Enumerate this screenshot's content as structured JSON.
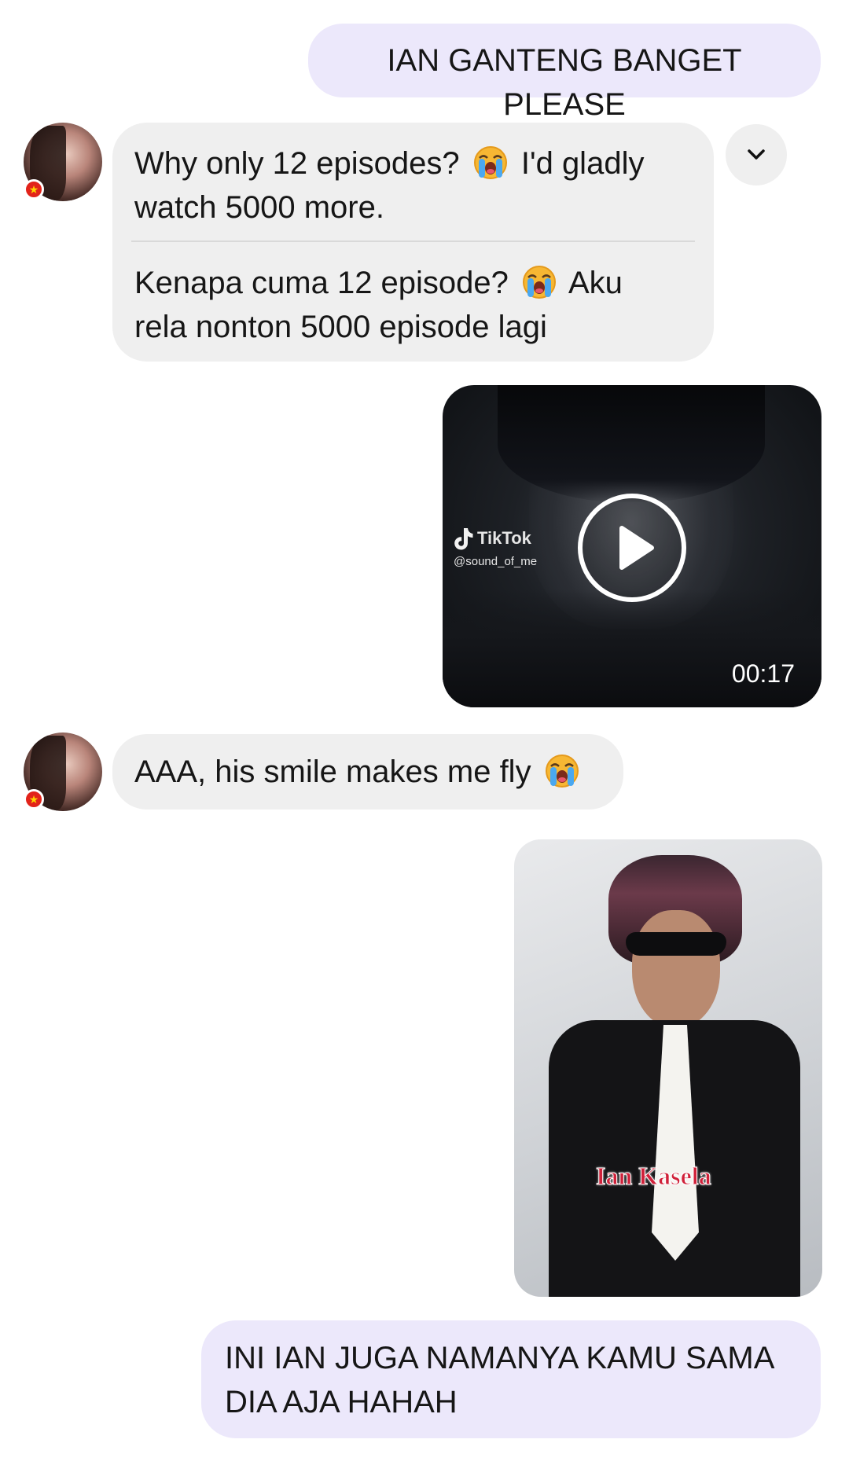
{
  "messages": {
    "m1": {
      "text": "IAN GANTENG BANGET PLEASE"
    },
    "m2": {
      "original": {
        "line1_a": "Why only 12 episodes?",
        "line1_b": "I'd gladly",
        "line2": "watch 5000 more."
      },
      "translation": {
        "line1_a": "Kenapa cuma 12 episode?",
        "line1_b": "Aku",
        "line2": "rela nonton 5000 episode lagi"
      }
    },
    "m3": {
      "tiktok_brand": "TikTok",
      "tiktok_handle": "@sound_of_me",
      "duration": "00:17"
    },
    "m4": {
      "text": "AAA, his smile makes me fly"
    },
    "m5": {
      "caption": "Ian Kasela"
    },
    "m6": {
      "line1": "INI IAN JUGA NAMANYA KAMU SAMA",
      "line2": "DIA AJA HAHAH"
    }
  },
  "icons": {
    "emoji": "loudly-crying-face",
    "expand": "chevron-down-icon",
    "play": "play-icon",
    "status": "star-badge"
  },
  "colors": {
    "outgoing_bubble": "#ece8fb",
    "incoming_bubble": "#efefef",
    "status_badge": "#e2231a",
    "caption_red": "#d0213a"
  }
}
